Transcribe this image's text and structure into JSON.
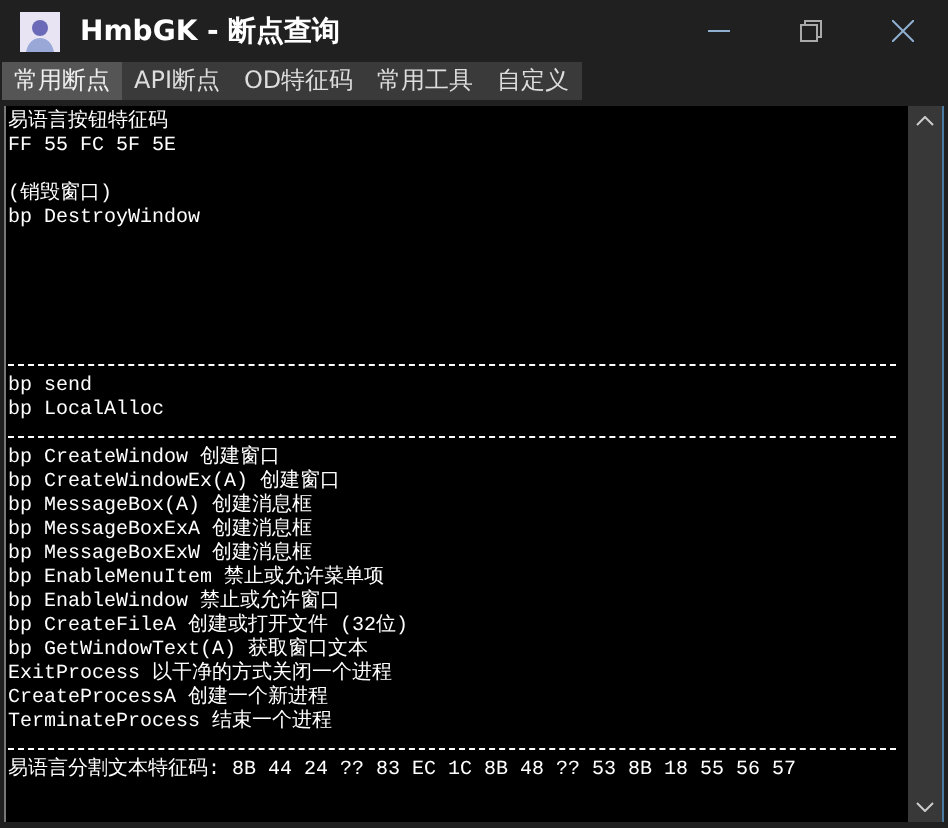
{
  "window": {
    "title": "HmbGK - 断点查询"
  },
  "tabs": [
    {
      "label": "常用断点",
      "selected": true
    },
    {
      "label": "API断点",
      "selected": false
    },
    {
      "label": "OD特征码",
      "selected": false
    },
    {
      "label": "常用工具",
      "selected": false
    },
    {
      "label": "自定义",
      "selected": false
    }
  ],
  "editor": {
    "lines": [
      {
        "kind": "text",
        "text": "易语言按钮特征码"
      },
      {
        "kind": "text",
        "text": "FF 55 FC 5F 5E"
      },
      {
        "kind": "blank"
      },
      {
        "kind": "text",
        "text": "(销毁窗口)"
      },
      {
        "kind": "text",
        "text": "bp DestroyWindow"
      },
      {
        "kind": "blank"
      },
      {
        "kind": "blank"
      },
      {
        "kind": "blank"
      },
      {
        "kind": "blank"
      },
      {
        "kind": "blank"
      },
      {
        "kind": "divider"
      },
      {
        "kind": "text",
        "text": "bp send"
      },
      {
        "kind": "text",
        "text": "bp LocalAlloc"
      },
      {
        "kind": "divider"
      },
      {
        "kind": "text",
        "text": "bp CreateWindow 创建窗口"
      },
      {
        "kind": "text",
        "text": "bp CreateWindowEx(A) 创建窗口"
      },
      {
        "kind": "text",
        "text": "bp MessageBox(A) 创建消息框"
      },
      {
        "kind": "text",
        "text": "bp MessageBoxExA 创建消息框"
      },
      {
        "kind": "text",
        "text": "bp MessageBoxExW 创建消息框"
      },
      {
        "kind": "text",
        "text": "bp EnableMenuItem 禁止或允许菜单项"
      },
      {
        "kind": "text",
        "text": "bp EnableWindow 禁止或允许窗口"
      },
      {
        "kind": "text",
        "text": "bp CreateFileA 创建或打开文件 (32位)"
      },
      {
        "kind": "text",
        "text": "bp GetWindowText(A) 获取窗口文本"
      },
      {
        "kind": "text",
        "text": "ExitProcess 以干净的方式关闭一个进程"
      },
      {
        "kind": "text",
        "text": "CreateProcessA 创建一个新进程"
      },
      {
        "kind": "text",
        "text": "TerminateProcess 结束一个进程"
      },
      {
        "kind": "divider"
      },
      {
        "kind": "text",
        "text": "易语言分割文本特征码: 8B 44 24 ?? 83 EC 1C 8B 48 ?? 53 8B 18 55 56 57"
      }
    ]
  }
}
